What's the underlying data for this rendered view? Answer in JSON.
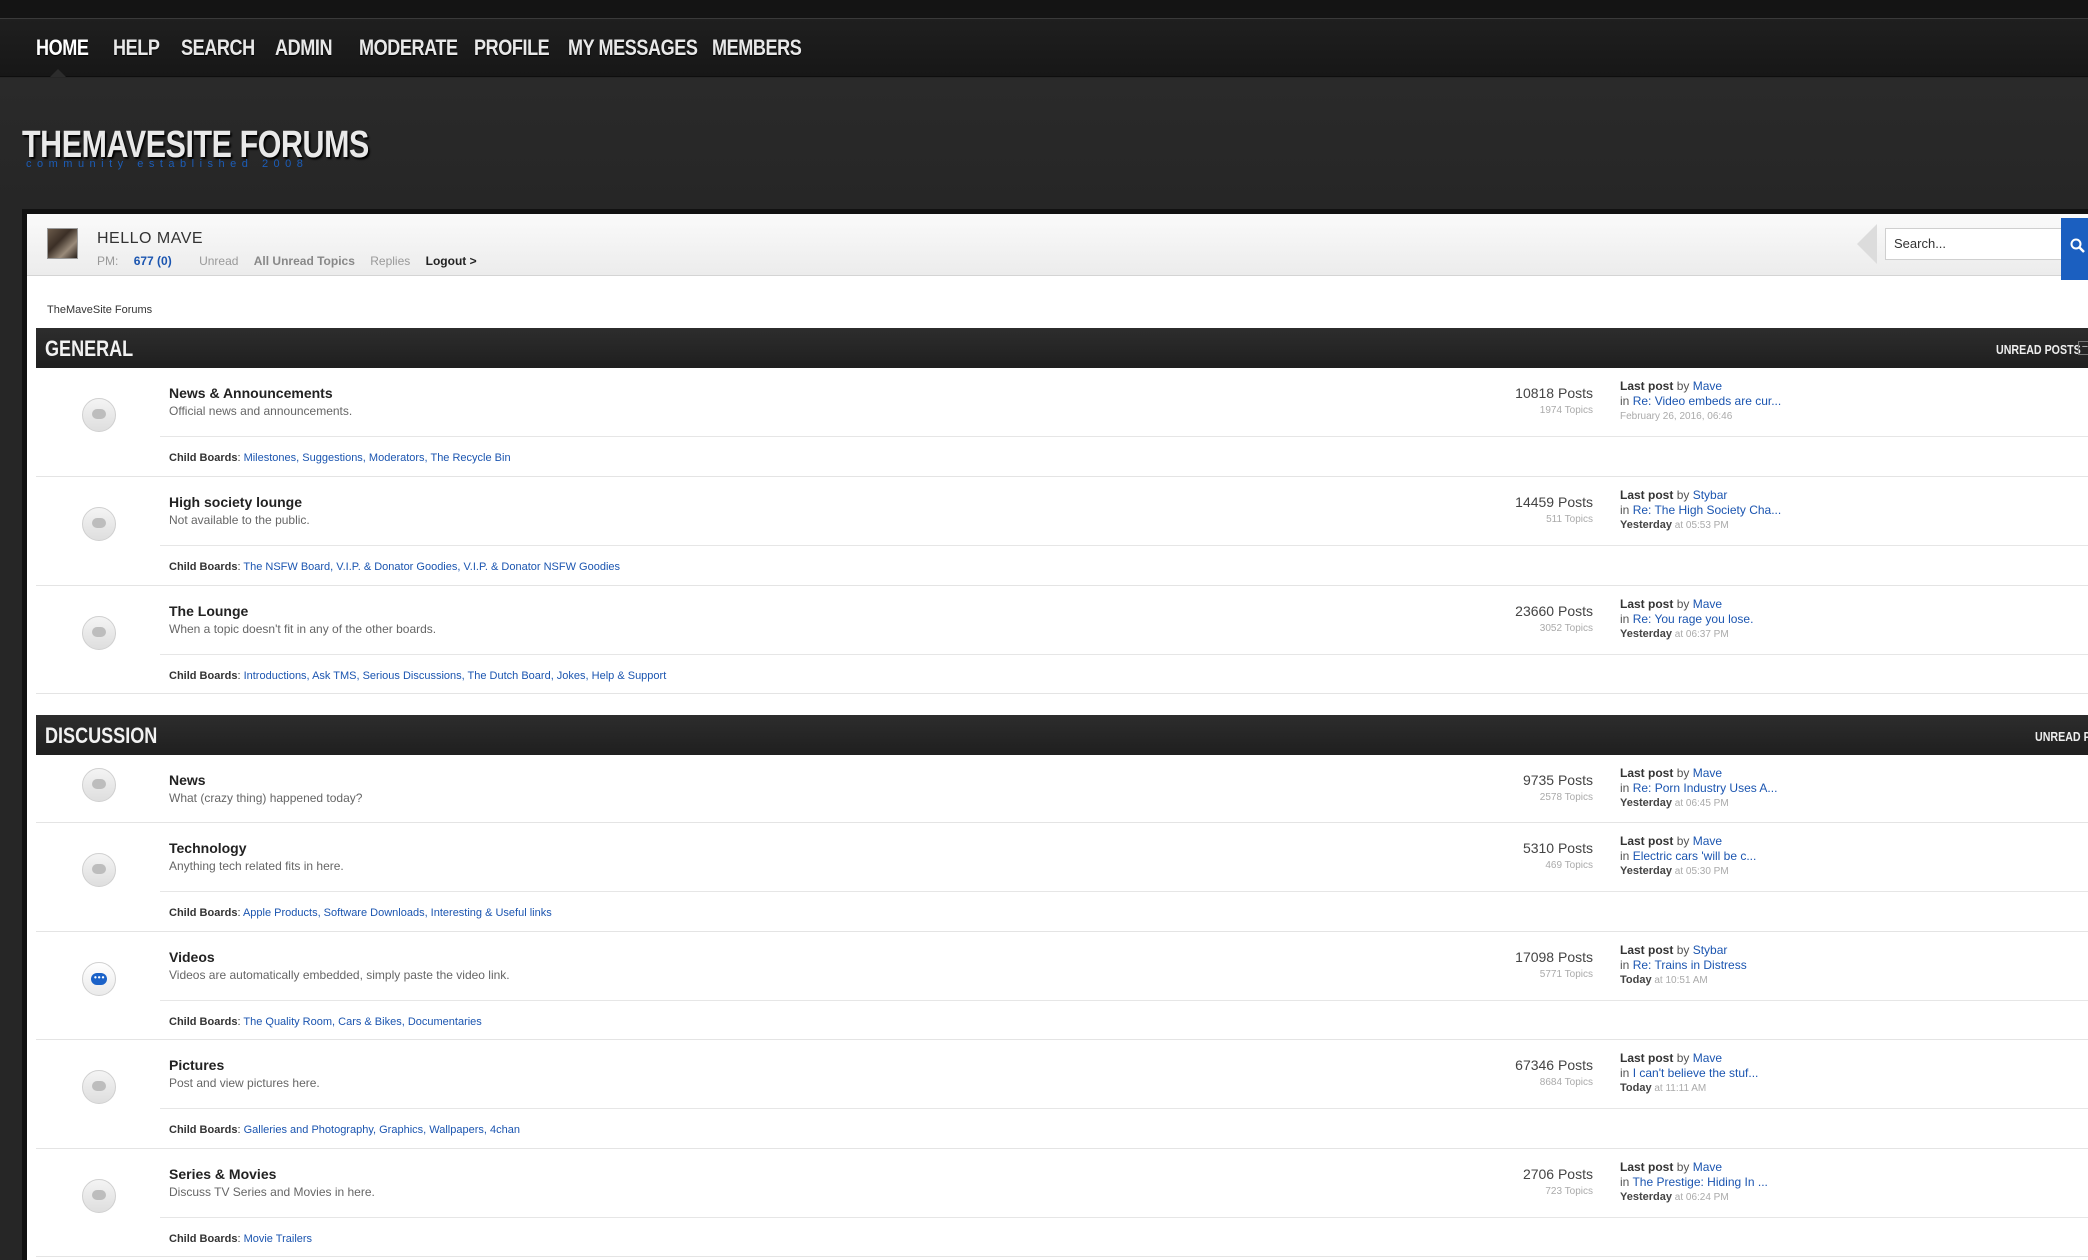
{
  "nav": {
    "items": [
      "HOME",
      "HELP",
      "SEARCH",
      "ADMIN",
      "MODERATE",
      "PROFILE",
      "MY MESSAGES",
      "MEMBERS"
    ]
  },
  "site": {
    "title": "THEMAVESITE FORUMS",
    "tagline": "community established 2008"
  },
  "userbar": {
    "greeting": "HELLO MAVE",
    "pm_label": "PM:",
    "pm_count": "677 (0)",
    "unread": "Unread",
    "all_unread": "All Unread Topics",
    "replies": "Replies",
    "logout": "Logout >",
    "search_placeholder": "Search..."
  },
  "breadcrumb": "TheMaveSite Forums",
  "categories": [
    {
      "title": "GENERAL",
      "unread_label": "UNREAD POSTS",
      "boards": [
        {
          "name": "News & Announcements",
          "desc": "Official news and announcements.",
          "posts": "10818 Posts",
          "topics": "1974 Topics",
          "last_by": "Mave",
          "last_topic": "Re: Video embeds are cur...",
          "last_day": "",
          "last_time": "February 26, 2016, 06:46",
          "child_boards": "Milestones, Suggestions, Moderators, The Recycle Bin"
        },
        {
          "name": "High society lounge",
          "desc": "Not available to the public.",
          "posts": "14459 Posts",
          "topics": "511 Topics",
          "last_by": "Stybar",
          "last_topic": "Re: The High Society Cha...",
          "last_day": "Yesterday",
          "last_time": "at 05:53 PM",
          "child_boards": "The NSFW Board, V.I.P. & Donator Goodies, V.I.P. & Donator NSFW Goodies"
        },
        {
          "name": "The Lounge",
          "desc": "When a topic doesn't fit in any of the other boards.",
          "posts": "23660 Posts",
          "topics": "3052 Topics",
          "last_by": "Mave",
          "last_topic": "Re: You rage you lose.",
          "last_day": "Yesterday",
          "last_time": "at 06:37 PM",
          "child_boards": "Introductions, Ask TMS, Serious Discussions, The Dutch Board, Jokes, Help & Support"
        }
      ]
    },
    {
      "title": "DISCUSSION",
      "unread_label": "UNREAD POSTS",
      "boards": [
        {
          "name": "News",
          "desc": "What (crazy thing) happened today?",
          "posts": "9735 Posts",
          "topics": "2578 Topics",
          "last_by": "Mave",
          "last_topic": "Re: Porn Industry Uses A...",
          "last_day": "Yesterday",
          "last_time": "at 06:45 PM",
          "child_boards": ""
        },
        {
          "name": "Technology",
          "desc": "Anything tech related fits in here.",
          "posts": "5310 Posts",
          "topics": "469 Topics",
          "last_by": "Mave",
          "last_topic": "Electric cars 'will be c...",
          "last_day": "Yesterday",
          "last_time": "at 05:30 PM",
          "child_boards": "Apple Products, Software Downloads, Interesting & Useful links"
        },
        {
          "name": "Videos",
          "desc": "Videos are automatically embedded, simply paste the video link.",
          "posts": "17098 Posts",
          "topics": "5771 Topics",
          "last_by": "Stybar",
          "last_topic": "Re: Trains in Distress",
          "last_day": "Today",
          "last_time": "at 10:51 AM",
          "child_boards": "The Quality Room, Cars & Bikes, Documentaries"
        },
        {
          "name": "Pictures",
          "desc": "Post and view pictures here.",
          "posts": "67346 Posts",
          "topics": "8684 Topics",
          "last_by": "Mave",
          "last_topic": "I can't believe the stuf...",
          "last_day": "Today",
          "last_time": "at 11:11 AM",
          "child_boards": "Galleries and Photography, Graphics, Wallpapers, 4chan"
        },
        {
          "name": "Series & Movies",
          "desc": "Discuss TV Series and Movies in here.",
          "posts": "2706 Posts",
          "topics": "723 Topics",
          "last_by": "Mave",
          "last_topic": "The Prestige: Hiding In ...",
          "last_day": "Yesterday",
          "last_time": "at 06:24 PM",
          "child_boards": "Movie Trailers"
        }
      ]
    }
  ],
  "labels": {
    "last_post": "Last post",
    "by": "by",
    "in": "in",
    "child_boards": "Child Boards"
  }
}
